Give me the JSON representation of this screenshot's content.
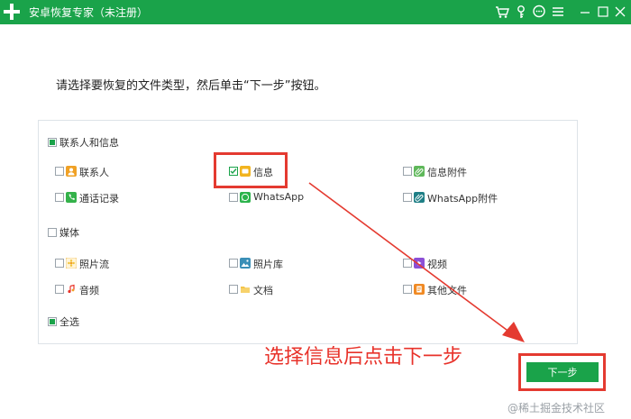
{
  "window": {
    "title": "安卓恢复专家（未注册）",
    "icons": [
      "plus-logo-icon",
      "cart-icon",
      "key-icon",
      "chat-icon",
      "menu-icon",
      "minimize-icon",
      "maximize-icon",
      "close-icon"
    ]
  },
  "instruction": "请选择要恢复的文件类型，然后单击“下一步”按钮。",
  "groups": {
    "contacts_messages": {
      "label": "联系人和信息",
      "items": {
        "contacts": "联系人",
        "messages": "信息",
        "message_attachments": "信息附件",
        "call_log": "通话记录",
        "whatsapp": "WhatsApp",
        "whatsapp_attachments": "WhatsApp附件"
      }
    },
    "media": {
      "label": "媒体",
      "items": {
        "camera_roll": "照片流",
        "photo_library": "照片库",
        "video": "视频",
        "audio": "音频",
        "documents": "文档",
        "other_files": "其他文件"
      }
    },
    "select_all": "全选"
  },
  "annotation": "选择信息后点击下一步",
  "next_button": "下一步",
  "watermark": "@稀土掘金技术社区",
  "colors": {
    "brand_green": "#1aa34a",
    "annotation_red": "#e43a30"
  }
}
